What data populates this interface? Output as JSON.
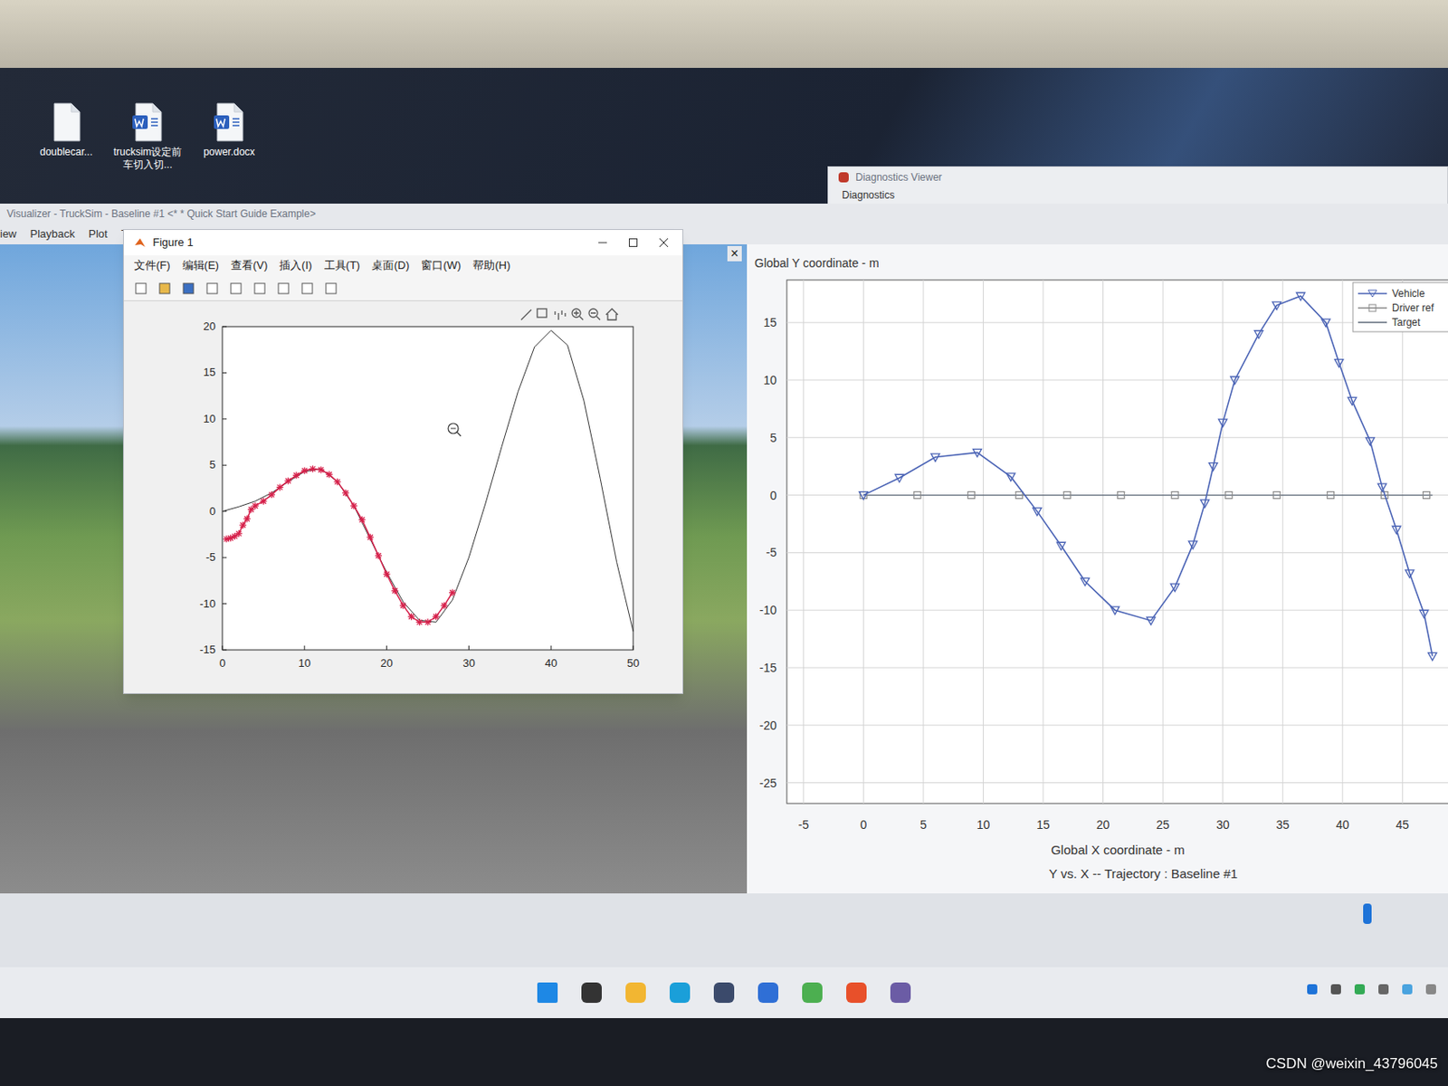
{
  "desktop_icons": [
    {
      "label": "doublecar..."
    },
    {
      "label": "trucksim设定前车切入切..."
    },
    {
      "label": "power.docx"
    }
  ],
  "diagnostics_window": {
    "title": "Diagnostics Viewer",
    "tab": "Diagnostics"
  },
  "main_window": {
    "title": "Visualizer - TruckSim - Baseline #1 <* * Quick Start Guide Example>",
    "menu": [
      "iew",
      "Playback",
      "Plot",
      "Tools"
    ],
    "pane_close": "×",
    "playback": {
      "level": 0.95
    }
  },
  "figure": {
    "title": "Figure 1",
    "menu": [
      "文件(F)",
      "编辑(E)",
      "查看(V)",
      "插入(I)",
      "工具(T)",
      "桌面(D)",
      "窗口(W)",
      "帮助(H)"
    ],
    "x_ticks": [
      "0",
      "10",
      "20",
      "30",
      "40",
      "50"
    ],
    "y_ticks": [
      "20",
      "15",
      "10",
      "5",
      "0",
      "-5",
      "-10",
      "-15"
    ],
    "reference": {
      "color": "#333333",
      "x": [
        0,
        2,
        4,
        6,
        8,
        10,
        12,
        14,
        16,
        18,
        20,
        22,
        24,
        26,
        28,
        30,
        32,
        34,
        36,
        38,
        40,
        42,
        44,
        46,
        48,
        50
      ],
      "y": [
        0,
        0.5,
        1.1,
        2.0,
        3.2,
        4.3,
        4.6,
        3.2,
        0.6,
        -3.0,
        -6.6,
        -9.8,
        -11.8,
        -12.0,
        -9.6,
        -5.0,
        0.8,
        7.0,
        13.0,
        17.8,
        19.6,
        18.0,
        12.0,
        3.5,
        -5.5,
        -13.0
      ]
    },
    "actual": {
      "color": "#d6204a",
      "x": [
        0.5,
        1,
        1.5,
        2,
        2.5,
        3,
        3.5,
        4,
        5,
        6,
        7,
        8,
        9,
        10,
        11,
        12,
        13,
        14,
        15,
        16,
        17,
        18,
        19,
        20,
        21,
        22,
        23,
        24,
        25,
        26,
        27,
        28
      ],
      "y": [
        -3,
        -2.9,
        -2.7,
        -2.4,
        -1.5,
        -0.8,
        0.2,
        0.6,
        1.1,
        1.8,
        2.6,
        3.3,
        3.9,
        4.4,
        4.6,
        4.5,
        4.0,
        3.2,
        2.0,
        0.6,
        -0.9,
        -2.8,
        -4.8,
        -6.8,
        -8.6,
        -10.2,
        -11.4,
        -12.0,
        -12.0,
        -11.4,
        -10.2,
        -8.8
      ]
    }
  },
  "trajectory_plot": {
    "y_label": "Global Y coordinate - m",
    "x_label": "Global X coordinate - m",
    "title": "Y vs. X -- Trajectory : Baseline #1",
    "x_ticks": [
      "-5",
      "0",
      "5",
      "10",
      "15",
      "20",
      "25",
      "30",
      "35",
      "40",
      "45"
    ],
    "y_ticks": [
      "15",
      "10",
      "5",
      "0",
      "-5",
      "-10",
      "-15",
      "-20",
      "-25"
    ],
    "series": [
      {
        "name": "Vehicle",
        "color": "#4a63b5",
        "x": [
          0,
          3,
          6,
          9.5,
          12.3,
          14.5,
          16.5,
          18.5,
          21,
          24,
          26,
          27.5,
          28.5,
          29.2,
          30,
          31,
          33,
          34.5,
          36.5,
          38.6,
          39.7,
          40.8,
          42.3,
          43.3,
          44.5,
          45.6,
          46.8,
          47.5
        ],
        "y": [
          0,
          1.5,
          3.3,
          3.7,
          1.6,
          -1.4,
          -4.4,
          -7.5,
          -10,
          -10.9,
          -8,
          -4.3,
          -0.7,
          2.5,
          6.3,
          10,
          14,
          16.5,
          17.3,
          15,
          11.5,
          8.2,
          4.7,
          0.7,
          -3,
          -6.8,
          -10.3,
          -14
        ]
      },
      {
        "name": "Driver ref",
        "color": "#8a8a8a",
        "x": [
          0,
          4.5,
          9,
          13,
          17,
          21.5,
          26,
          30.5,
          34.5,
          39,
          43.5,
          47
        ],
        "y": [
          0,
          0,
          0,
          0,
          0,
          0,
          0,
          0,
          0,
          0,
          0,
          0
        ]
      },
      {
        "name": "Target",
        "color": "#5f6b7a",
        "x": [
          0,
          47.5
        ],
        "y": [
          0,
          0
        ]
      }
    ]
  },
  "watermark": "CSDN @weixin_43796045"
}
